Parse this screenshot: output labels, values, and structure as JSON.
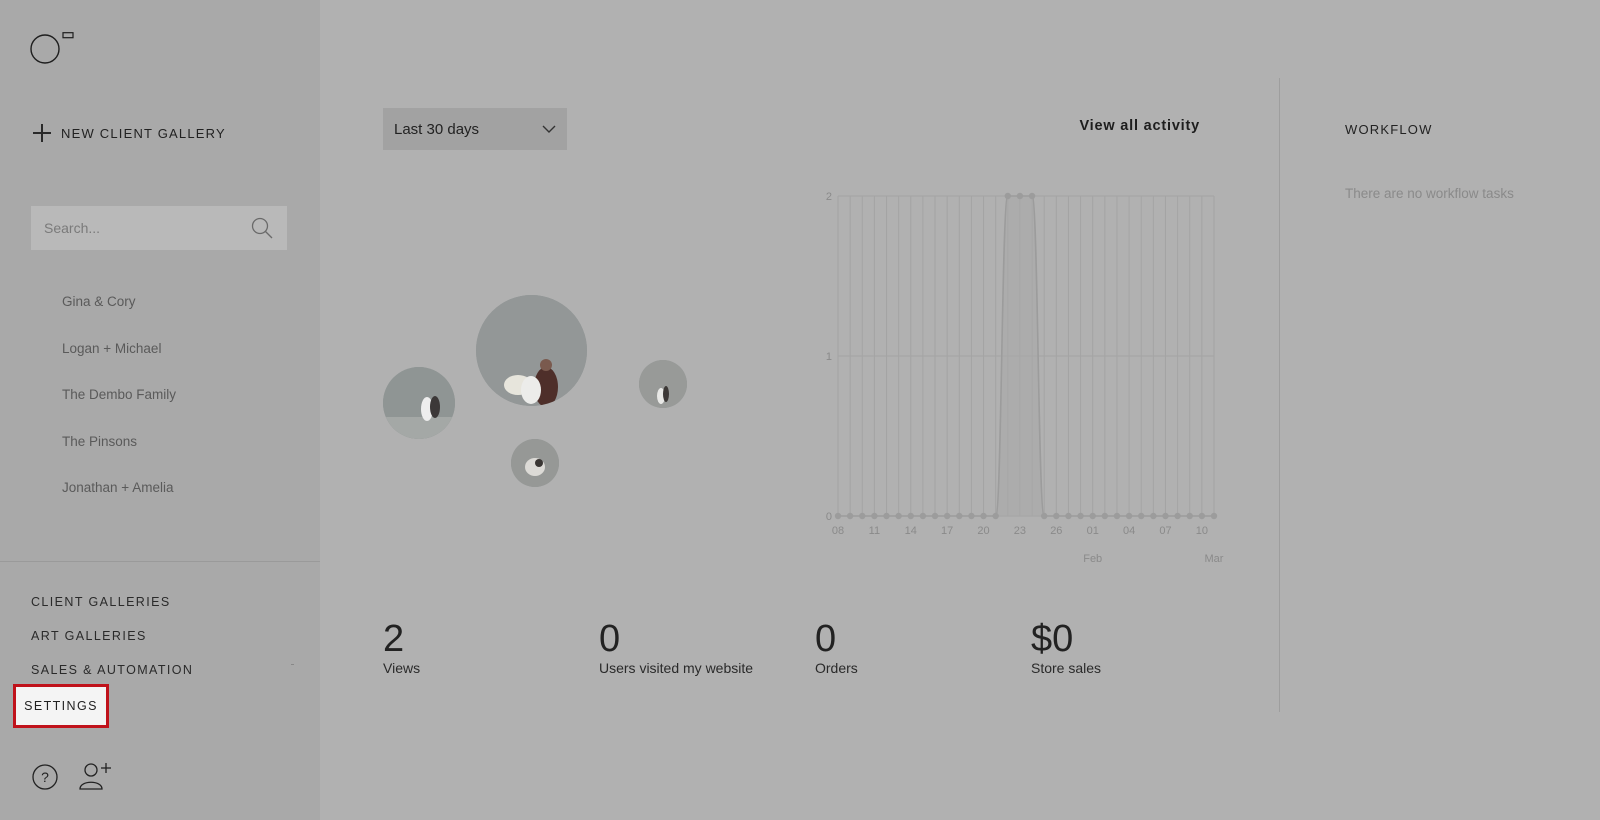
{
  "sidebar": {
    "new_gallery_label": "NEW CLIENT GALLERY",
    "search_placeholder": "Search...",
    "galleries": [
      "Gina & Cory",
      "Logan + Michael",
      "The Dembo Family",
      "The Pinsons",
      "Jonathan + Amelia"
    ],
    "nav": {
      "client_galleries": "CLIENT GALLERIES",
      "art_galleries": "ART GALLERIES",
      "sales_automation": "SALES & AUTOMATION",
      "settings": "SETTINGS"
    }
  },
  "main": {
    "range_select": "Last 30 days",
    "view_all": "View all activity",
    "stats": [
      {
        "value": "2",
        "label": "Views"
      },
      {
        "value": "0",
        "label": "Users visited my website"
      },
      {
        "value": "0",
        "label": "Orders"
      },
      {
        "value": "$0",
        "label": "Store sales"
      }
    ]
  },
  "workflow": {
    "title": "WORKFLOW",
    "empty_text": "There are no workflow tasks"
  },
  "chart_data": {
    "type": "area",
    "x_tick_labels": [
      "08",
      "11",
      "14",
      "17",
      "20",
      "23",
      "26",
      "01",
      "04",
      "07",
      "10"
    ],
    "month_labels": [
      "Feb",
      "Mar"
    ],
    "y_ticks": [
      "0",
      "1",
      "2"
    ],
    "ylim": [
      0,
      2
    ],
    "values": [
      0,
      0,
      0,
      0,
      0,
      0,
      0,
      0,
      0,
      0,
      0,
      0,
      0,
      0,
      2,
      2,
      2,
      0,
      0,
      0,
      0,
      0,
      0,
      0,
      0,
      0,
      0,
      0,
      0,
      0,
      0,
      0
    ],
    "grid": true
  },
  "colors": {
    "highlight": "#c0121b",
    "chart_line": "#9c9c9c"
  }
}
